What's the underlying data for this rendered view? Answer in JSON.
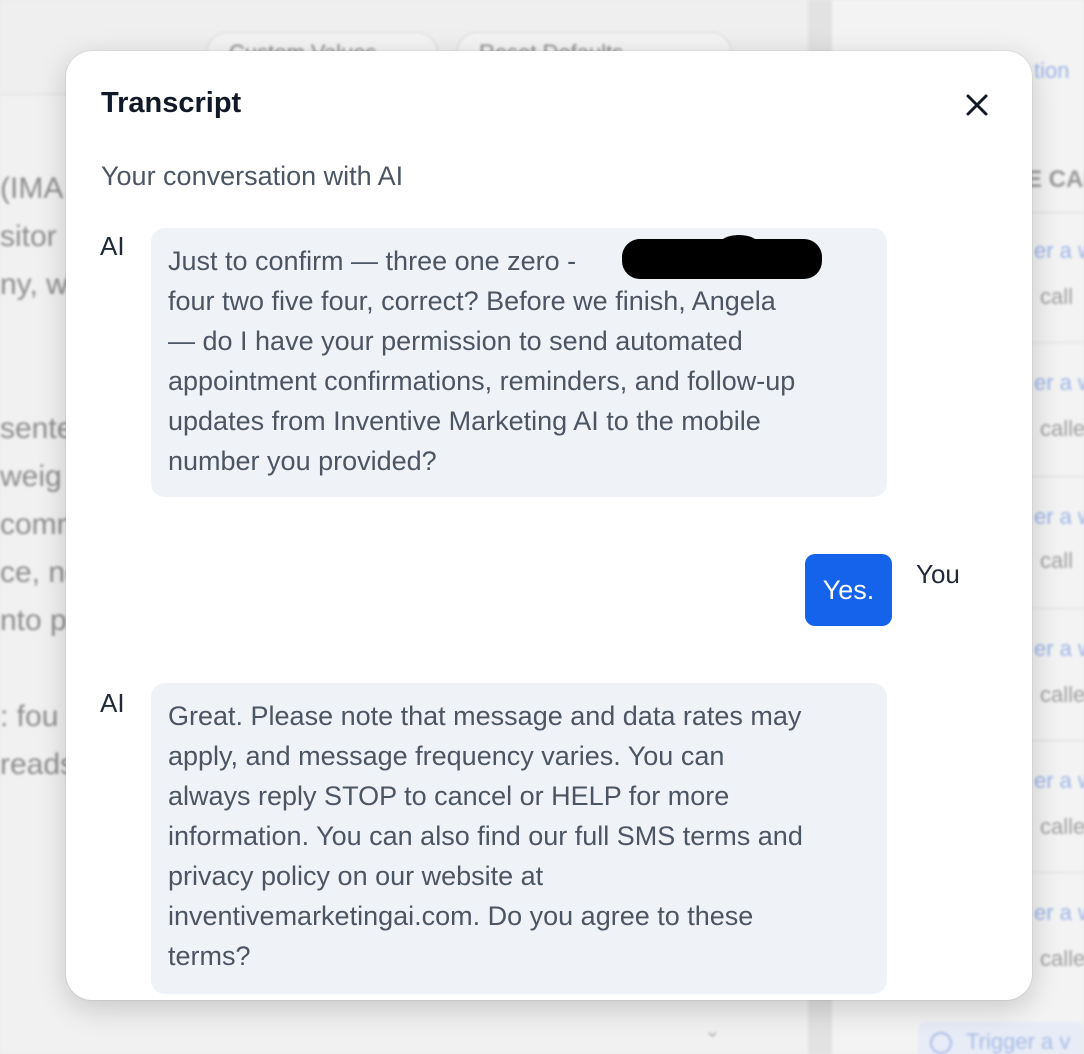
{
  "background": {
    "pills": [
      "Custom Values",
      "Reset Defaults"
    ],
    "left_text": [
      "(IMA",
      "sitor",
      "ny, w",
      "sente",
      " weig",
      "comm",
      "ce, no",
      "nto p",
      ": fou",
      "reads"
    ],
    "right_header": "E CAL",
    "right_top_link": "tion",
    "right_links": [
      "er a w",
      "er a w",
      "er a w",
      "er a w",
      "er a w",
      "er a w"
    ],
    "right_texts": [
      "call",
      "calle",
      "call",
      "calle",
      "calle",
      "calle"
    ],
    "trigger_label": "Trigger a v",
    "chevron": "⌄"
  },
  "modal": {
    "title": "Transcript",
    "close_icon": "close-icon",
    "subtitle": "Your conversation with AI",
    "messages": [
      {
        "speaker": "AI",
        "text": "Just to confirm — three one zero - ████████ e - four two five four, correct? Before we finish, Angela — do I have your permission to send automated appointment confirmations, reminders, and follow-up updates from Inventive Marketing AI to the mobile number you provided?",
        "lines": [
          "Just to confirm — three one zero -                      e -",
          "four two five four, correct? Before we finish, Angela",
          "— do I have your permission to send automated",
          "appointment confirmations, reminders, and follow-up",
          "updates from Inventive Marketing AI to the mobile",
          "number you provided?"
        ]
      },
      {
        "speaker": "You",
        "text": "Yes."
      },
      {
        "speaker": "AI",
        "lines": [
          "Great. Please note that message and data rates may",
          "apply, and message frequency varies. You can",
          "always reply STOP to cancel or HELP for more",
          "information. You can also find our full SMS terms and",
          "privacy policy on our website at",
          "inventivemarketingai.com. Do you agree to these",
          "terms?"
        ]
      }
    ]
  },
  "colors": {
    "user_bubble": "#1563ea",
    "ai_bubble": "#eff2f6"
  }
}
